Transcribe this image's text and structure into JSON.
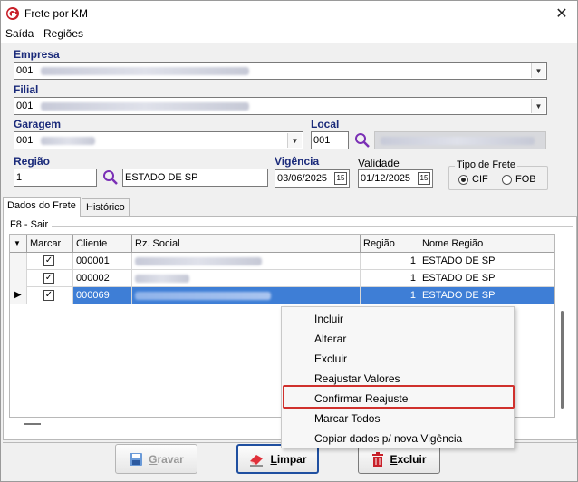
{
  "window": {
    "title": "Frete por KM"
  },
  "menu": {
    "items": [
      "Saída",
      "Regiões"
    ]
  },
  "form": {
    "empresa": {
      "label": "Empresa",
      "code": "001"
    },
    "filial": {
      "label": "Filial",
      "code": "001"
    },
    "garagem": {
      "label": "Garagem",
      "code": "001"
    },
    "local": {
      "label": "Local",
      "code": "001"
    },
    "regiao": {
      "label": "Região",
      "code": "1",
      "name": "ESTADO DE SP"
    },
    "vigencia": {
      "label": "Vigência",
      "value": "03/06/2025"
    },
    "validade": {
      "label": "Validade",
      "value": "01/12/2025"
    },
    "tipo_frete": {
      "label": "Tipo de Frete",
      "options": [
        "CIF",
        "FOB"
      ],
      "selected": "CIF"
    },
    "calendar_glyph": "15"
  },
  "tabs": [
    "Dados do Frete",
    "Histórico"
  ],
  "grid": {
    "caption": "F8 - Sair",
    "columns": [
      "Marcar",
      "Cliente",
      "Rz. Social",
      "Região",
      "Nome Região"
    ],
    "rows": [
      {
        "marcar": true,
        "cliente": "000001",
        "regiao": "1",
        "nome_regiao": "ESTADO DE SP"
      },
      {
        "marcar": true,
        "cliente": "000002",
        "regiao": "1",
        "nome_regiao": "ESTADO DE SP"
      },
      {
        "marcar": true,
        "cliente": "000069",
        "regiao": "1",
        "nome_regiao": "ESTADO DE SP"
      }
    ]
  },
  "context_menu": {
    "items": [
      "Incluir",
      "Alterar",
      "Excluir",
      "Reajustar Valores",
      "Confirmar Reajuste",
      "Marcar Todos",
      "Copiar dados p/ nova Vigência"
    ],
    "highlighted": "Confirmar Reajuste"
  },
  "buttons": {
    "gravar": {
      "prefix": "",
      "accel": "G",
      "rest": "ravar"
    },
    "limpar": {
      "prefix": "",
      "accel": "L",
      "rest": "impar"
    },
    "excluir": {
      "prefix": "",
      "accel": "E",
      "rest": "xcluir"
    }
  },
  "colors": {
    "label_blue": "#1a2a7a",
    "selection": "#3e7ed6",
    "highlight_border": "#d0312d"
  }
}
